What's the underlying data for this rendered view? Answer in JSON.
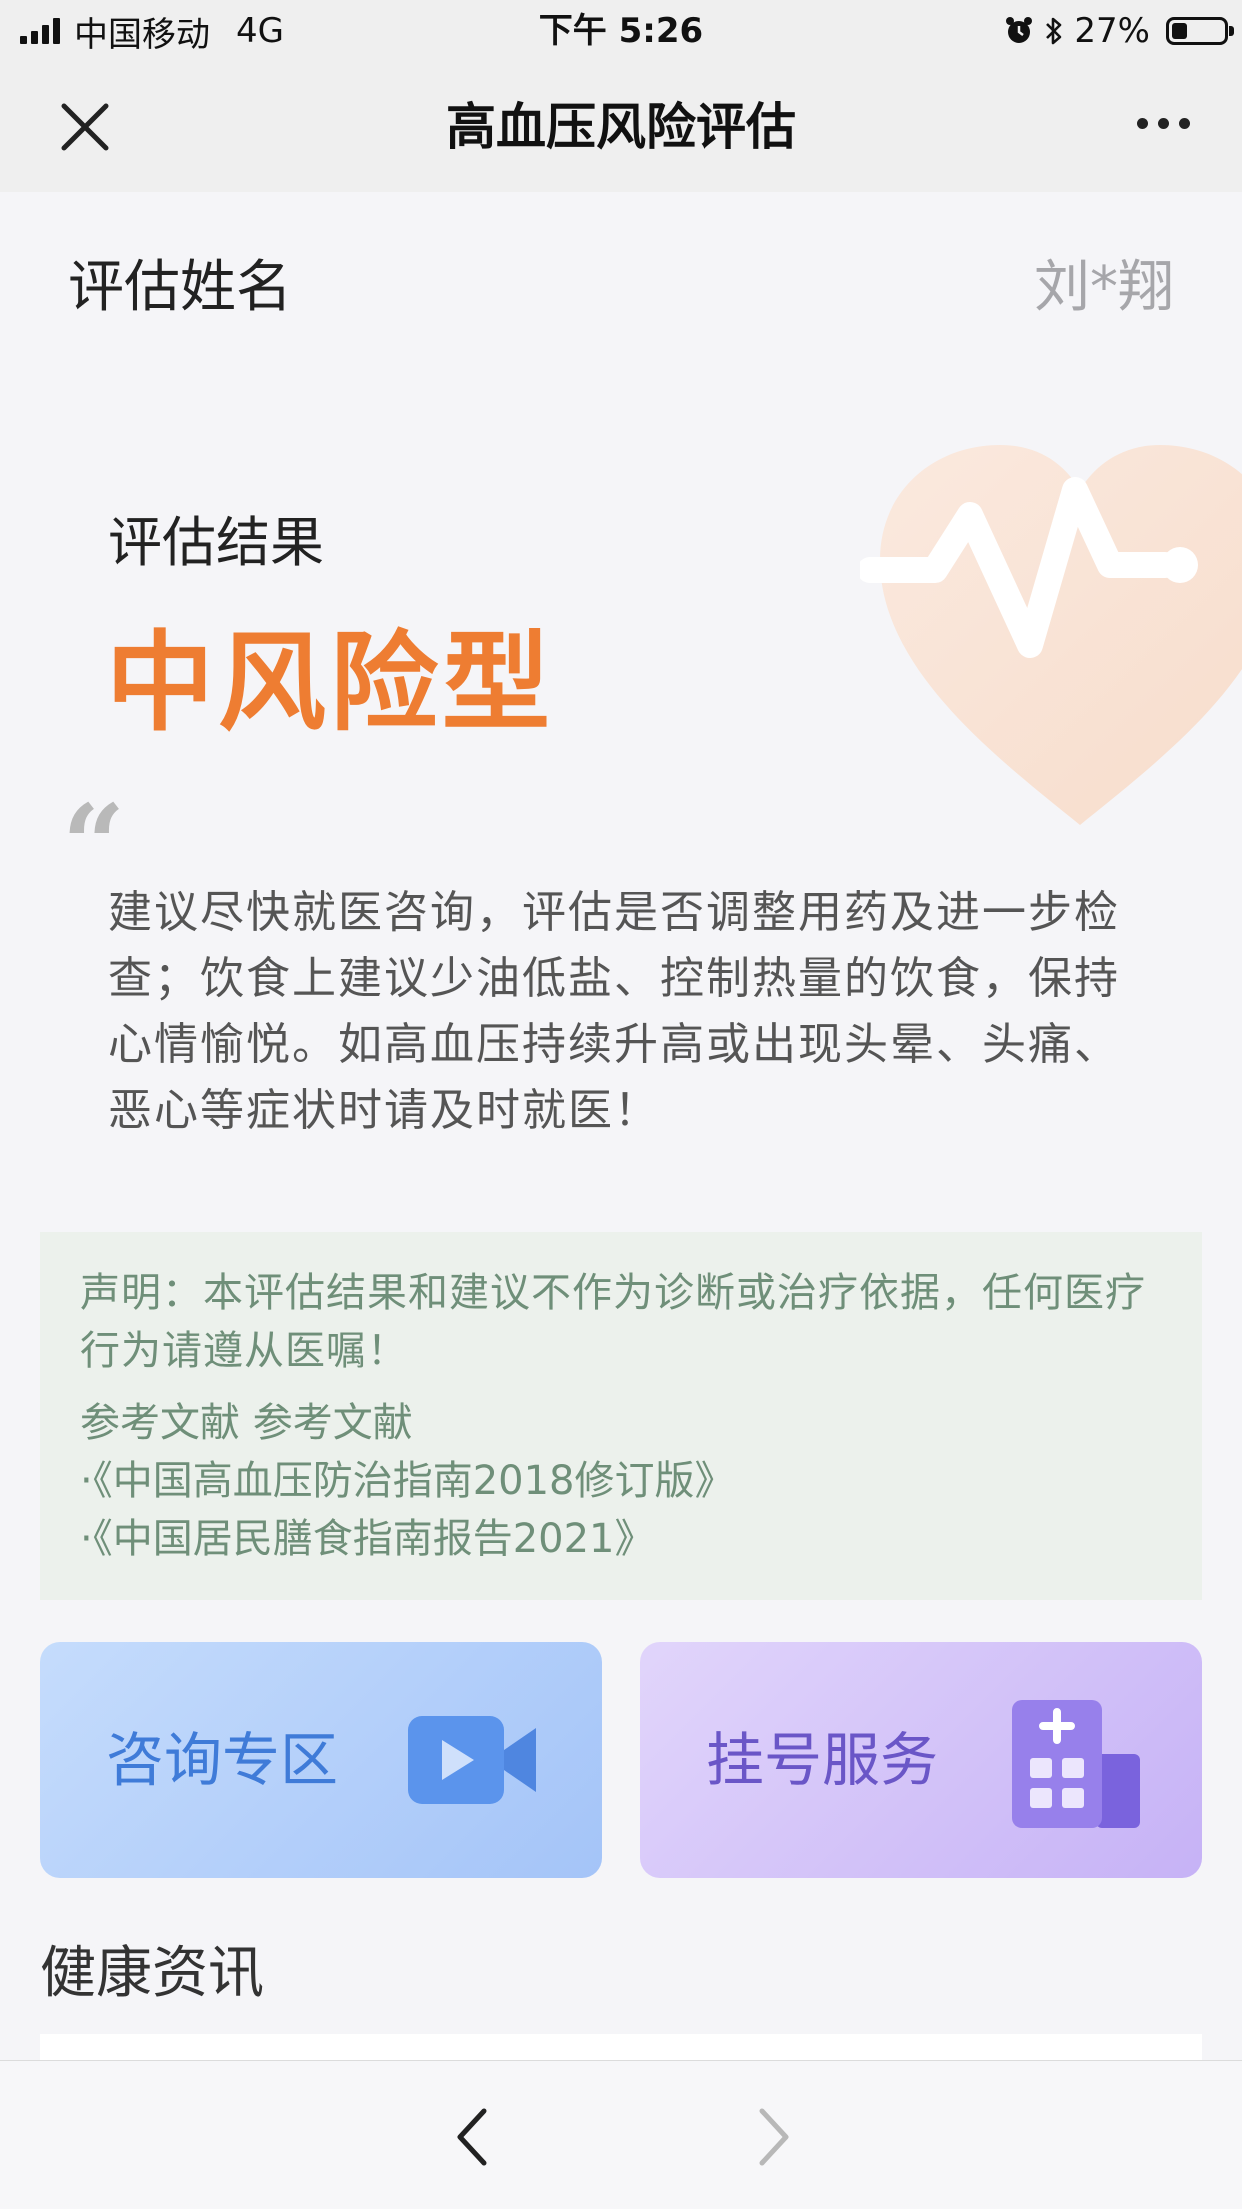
{
  "status_bar": {
    "carrier": "中国移动",
    "network": "4G",
    "time": "下午 5:26",
    "battery_percent": "27%",
    "battery_level": 0.27
  },
  "navbar": {
    "title": "高血压风险评估",
    "close_icon": "close-icon",
    "more_icon": "more-icon"
  },
  "assessment": {
    "name_label": "评估姓名",
    "name_value": "刘*翔",
    "result_label": "评估结果",
    "result_value": "中风险型",
    "quote_mark": "“",
    "advice": "建议尽快就医咨询，评估是否调整用药及进一步检查；饮食上建议少油低盐、控制热量的饮食，保持心情愉悦。如高血压持续升高或出现头晕、头痛、恶心等症状时请及时就医！"
  },
  "disclaimer": {
    "statement": "声明：本评估结果和建议不作为诊断或治疗依据，任何医疗行为请遵从医嘱！",
    "references_title": "参考文献 参考文献",
    "references": [
      "·《中国高血压防治指南2018修订版》",
      "·《中国居民膳食指南报告2021》"
    ]
  },
  "services": {
    "consult_label": "咨询专区",
    "register_label": "挂号服务"
  },
  "news": {
    "title": "健康资讯"
  },
  "colors": {
    "accent_orange": "#ee7d32",
    "consult_blue": "#3f7bd8",
    "register_purple": "#6a56c7",
    "disclaimer_green": "#6f8f79"
  }
}
